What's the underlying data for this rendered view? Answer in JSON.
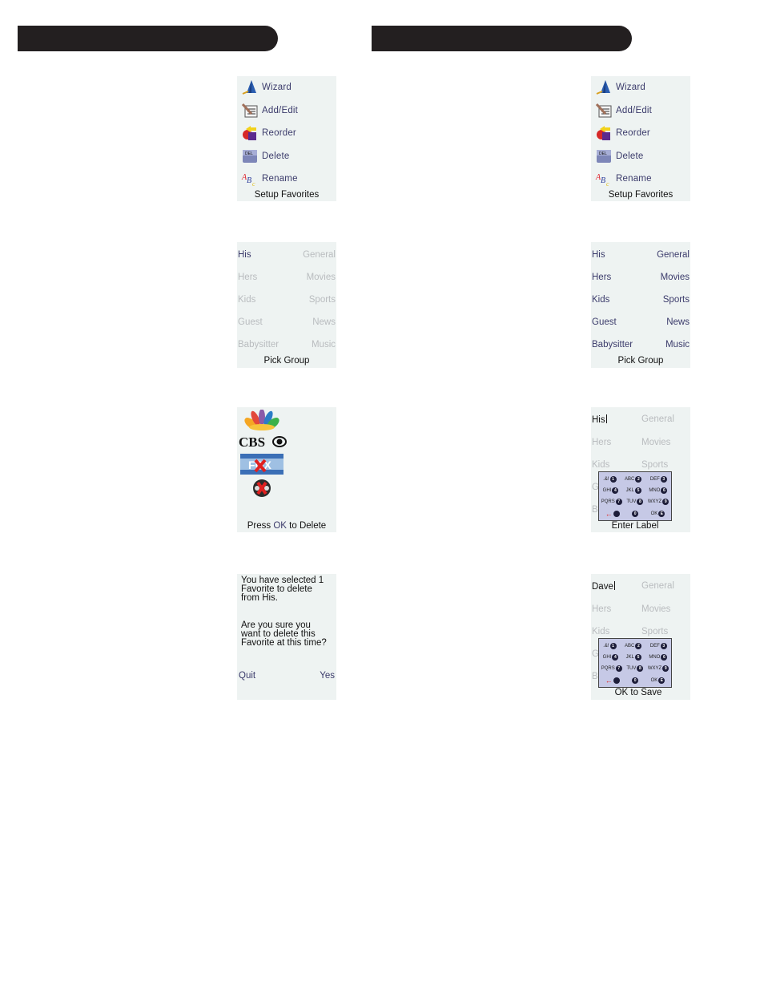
{
  "headers": [
    {
      "label": ""
    },
    {
      "label": ""
    }
  ],
  "setup_favorites_menu": {
    "items": [
      {
        "label": "Wizard",
        "icon": "wizard-hat-icon"
      },
      {
        "label": "Add/Edit",
        "icon": "add-edit-icon"
      },
      {
        "label": "Reorder",
        "icon": "reorder-icon"
      },
      {
        "label": "Delete",
        "icon": "delete-key-icon",
        "icon_text": "DEL"
      },
      {
        "label": "Rename",
        "icon": "rename-abc-icon"
      }
    ],
    "caption": "Setup Favorites"
  },
  "pick_group": {
    "left": [
      "His",
      "Hers",
      "Kids",
      "Guest",
      "Babysitter"
    ],
    "right": [
      "General",
      "Movies",
      "Sports",
      "News",
      "Music"
    ],
    "caption": "Pick Group"
  },
  "delete_channels": {
    "logos": [
      "nbc-peacock",
      "CBS",
      "FOX",
      "channel-logo"
    ],
    "cbs_text": "CBS",
    "fox_text": "FOX",
    "caption_pre": "Press ",
    "caption_ok": "OK",
    "caption_post": " to Delete"
  },
  "confirm_delete": {
    "message1": [
      "You have selected 1",
      "Favorite to delete",
      "from His."
    ],
    "message2": [
      "Are you sure you",
      "want to delete this",
      "Favorite at this time?"
    ],
    "quit_label": "Quit",
    "yes_label": "Yes"
  },
  "enter_label": {
    "input_value": "His",
    "left": [
      "Hers",
      "Kids",
      "G",
      "B"
    ],
    "right": [
      "General",
      "Movies",
      "Sports"
    ],
    "caption": "Enter Label"
  },
  "ok_to_save": {
    "input_value": "Dave",
    "left": [
      "Hers",
      "Kids",
      "G",
      "B"
    ],
    "right": [
      "General",
      "Movies",
      "Sports"
    ],
    "caption": "OK to Save"
  },
  "keypad": {
    "rows": [
      [
        {
          "letters": ".&!",
          "digit": "1"
        },
        {
          "letters": "ABC",
          "digit": "2"
        },
        {
          "letters": "DEF",
          "digit": "3"
        }
      ],
      [
        {
          "letters": "GHI",
          "digit": "4"
        },
        {
          "letters": "JKL",
          "digit": "5"
        },
        {
          "letters": "MNO",
          "digit": "6"
        }
      ],
      [
        {
          "letters": "PQRS",
          "digit": "7"
        },
        {
          "letters": "TUV",
          "digit": "8"
        },
        {
          "letters": "WXYZ",
          "digit": "9"
        }
      ],
      [
        {
          "letters": "←",
          "digit": ""
        },
        {
          "letters": "",
          "digit": "0"
        },
        {
          "letters": "OK",
          "digit": "E"
        }
      ]
    ]
  }
}
